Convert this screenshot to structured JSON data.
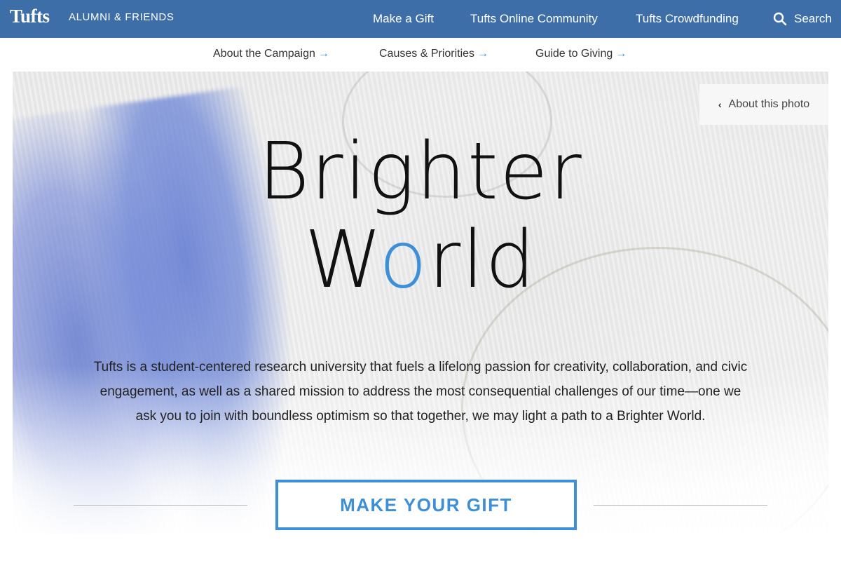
{
  "header": {
    "logo": "Tufts",
    "brand_sub": "ALUMNI & FRIENDS",
    "nav": [
      {
        "label": "Make a Gift"
      },
      {
        "label": "Tufts Online Community"
      },
      {
        "label": "Tufts Crowdfunding"
      }
    ],
    "search_label": "Search"
  },
  "subnav": {
    "items": [
      {
        "label": "About the Campaign",
        "arrow": "→"
      },
      {
        "label": "Causes & Priorities",
        "arrow": "→"
      },
      {
        "label": "Guide to Giving",
        "arrow": "→"
      }
    ]
  },
  "hero": {
    "about_photo": "About this photo",
    "about_photo_chevron": "‹",
    "title_line1": "Brighter",
    "title_line2_pre": "W",
    "title_line2_accent": "o",
    "title_line2_post": "rld",
    "body": "Tufts is a student-centered research university that fuels a lifelong passion for creativity, collaboration, and civic engagement, as well as a shared mission to address the most consequential challenges of our time—one we ask you to join with boundless optimism so that together, we may light a path to a Brighter World.",
    "cta_label": "MAKE YOUR GIFT"
  },
  "colors": {
    "header_bg": "#3e6ea8",
    "accent": "#3d8fd8"
  }
}
